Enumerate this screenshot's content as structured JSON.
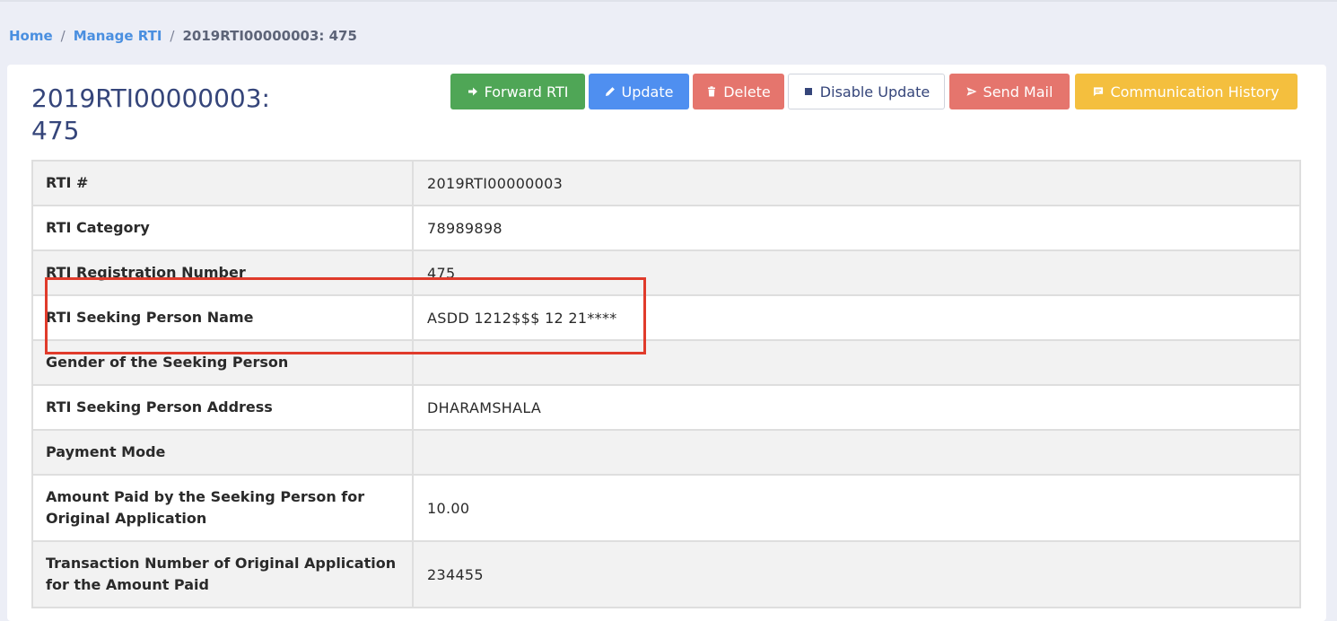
{
  "breadcrumb": {
    "home": "Home",
    "manage": "Manage RTI",
    "current": "2019RTI00000003: 475",
    "separator": "/"
  },
  "page": {
    "title": "2019RTI00000003: 475"
  },
  "toolbar": {
    "forward": "Forward RTI",
    "update": "Update",
    "delete": "Delete",
    "disable_update": "Disable Update",
    "send_mail": "Send Mail",
    "communication_history": "Communication History"
  },
  "details": [
    {
      "label": "RTI #",
      "value": "2019RTI00000003"
    },
    {
      "label": "RTI Category",
      "value": "78989898"
    },
    {
      "label": "RTI Registration Number",
      "value": "475"
    },
    {
      "label": "RTI Seeking Person Name",
      "value": "ASDD 1212$$$ 12 21****"
    },
    {
      "label": "Gender of the Seeking Person",
      "value": ""
    },
    {
      "label": "RTI Seeking Person Address",
      "value": "DHARAMSHALA"
    },
    {
      "label": "Payment Mode",
      "value": ""
    },
    {
      "label": "Amount Paid by the Seeking Person for Original Application",
      "value": "10.00"
    },
    {
      "label": "Transaction Number of Original Application for the Amount Paid",
      "value": "234455"
    }
  ],
  "colors": {
    "forward": "#4fa656",
    "update": "#4f8ff0",
    "delete": "#e5756d",
    "send_mail": "#e5756d",
    "communication_history": "#f4bf3e",
    "highlight": "#e03b2b"
  }
}
